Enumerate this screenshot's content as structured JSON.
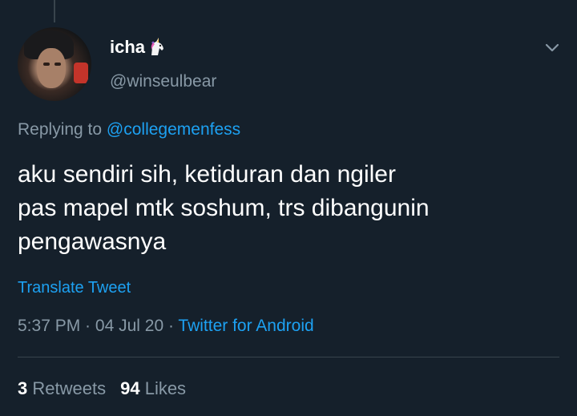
{
  "tweet": {
    "author": {
      "display_name": "icha",
      "emoji": "unicorn",
      "handle": "@winseulbear"
    },
    "replying_prefix": "Replying to",
    "replying_to": "@collegemenfess",
    "text_lines": [
      "aku sendiri sih, ketiduran dan ngiler",
      "pas mapel mtk soshum, trs dibangunin",
      "pengawasnya"
    ],
    "translate_label": "Translate Tweet",
    "time": "5:37 PM",
    "date": "04 Jul 20",
    "source": "Twitter for Android",
    "separator": " · ",
    "retweets_count": "3",
    "retweets_label": "Retweets",
    "likes_count": "94",
    "likes_label": "Likes"
  },
  "colors": {
    "background": "#15202b",
    "secondary_text": "#8899a6",
    "link": "#1da1f2",
    "divider": "#38444d"
  },
  "icons": {
    "menu": "chevron-down-icon",
    "emoji": "unicorn-icon"
  }
}
